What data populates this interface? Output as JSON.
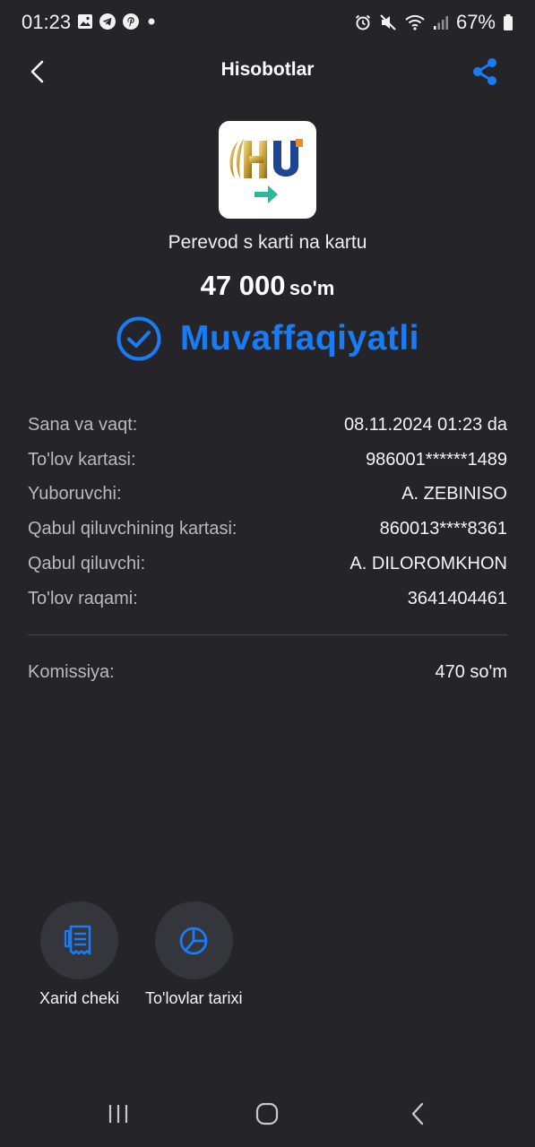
{
  "status_bar": {
    "time": "01:23",
    "battery": "67%",
    "icons": [
      "gallery-icon",
      "telegram-icon",
      "pinterest-icon",
      "dot-icon",
      "alarm-icon",
      "mute-icon",
      "wifi-icon",
      "signal-icon",
      "battery-icon"
    ]
  },
  "header": {
    "title": "Hisobotlar",
    "back_icon": "chevron-left-icon",
    "share_icon": "share-icon"
  },
  "transaction": {
    "service_name": "Perevod s karti na kartu",
    "amount": "47 000",
    "currency": "so'm",
    "status": "Muvaffaqiyatli"
  },
  "details": [
    {
      "label": "Sana va vaqt:",
      "value": "08.11.2024 01:23 da"
    },
    {
      "label": "To'lov kartasi:",
      "value": "986001******1489"
    },
    {
      "label": "Yuboruvchi:",
      "value": "A. ZEBINISO"
    },
    {
      "label": "Qabul qiluvchining kartasi:",
      "value": "860013****8361"
    },
    {
      "label": "Qabul qiluvchi:",
      "value": "A. DILOROMKHON"
    },
    {
      "label": "To'lov raqami:",
      "value": "3641404461"
    }
  ],
  "commission": {
    "label": "Komissiya:",
    "value": "470 so'm"
  },
  "actions": [
    {
      "label": "Xarid cheki",
      "icon": "receipt-icon"
    },
    {
      "label": "To'lovlar tarixi",
      "icon": "pie-chart-icon"
    }
  ],
  "colors": {
    "background": "#242429",
    "accent": "#1a7cf5",
    "label": "#b9b9be",
    "action_circle": "#35353c"
  }
}
